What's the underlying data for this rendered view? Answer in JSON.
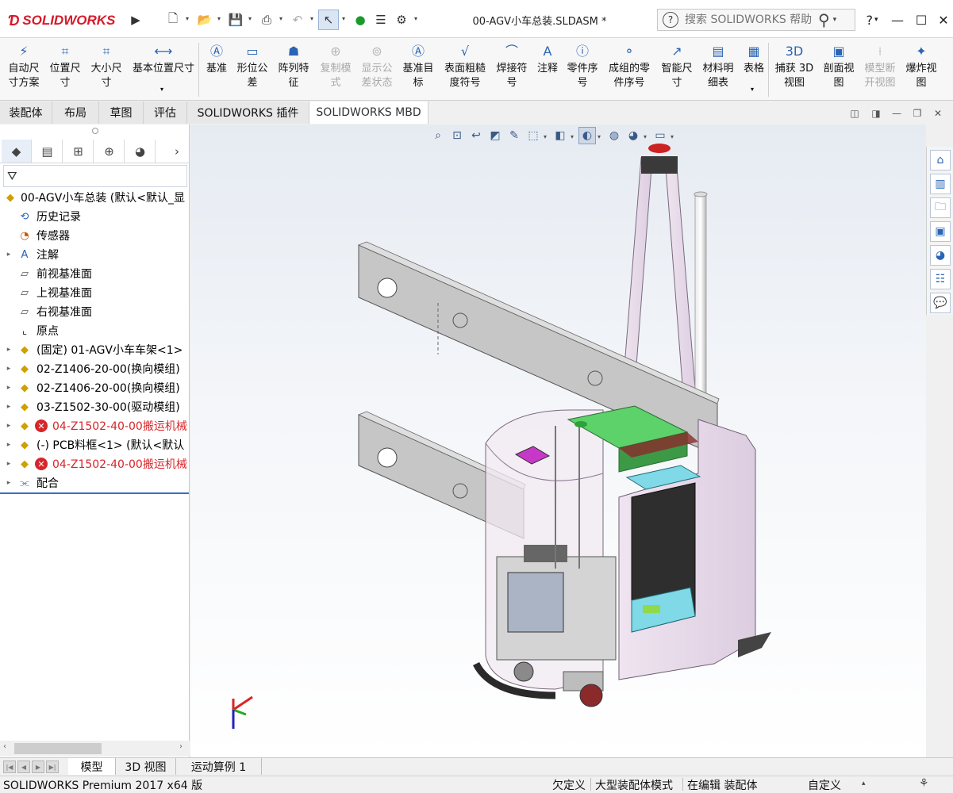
{
  "app": {
    "logo_text": "SOLIDWORKS",
    "document_title": "00-AGV小车总装.SLDASM *",
    "search_placeholder": "搜索 SOLIDWORKS 帮助",
    "help_label": "?"
  },
  "ribbon": {
    "items": [
      {
        "label": "自动尺\n寸方案",
        "icon": "auto-dimension-icon"
      },
      {
        "label": "位置尺\n寸",
        "icon": "location-dimension-icon"
      },
      {
        "label": "大小尺\n寸",
        "icon": "size-dimension-icon"
      },
      {
        "label": "基本位置尺寸",
        "icon": "basic-location-dimension-icon"
      },
      {
        "label": "基准",
        "icon": "datum-icon"
      },
      {
        "label": "形位公\n差",
        "icon": "geometric-tolerance-icon"
      },
      {
        "label": "阵列特\n征",
        "icon": "pattern-feature-icon"
      },
      {
        "label": "复制模\n式",
        "icon": "copy-scheme-icon",
        "disabled": true
      },
      {
        "label": "显示公\n差状态",
        "icon": "tolerance-status-icon",
        "disabled": true
      },
      {
        "label": "基准目\n标",
        "icon": "datum-target-icon"
      },
      {
        "label": "表面粗糙\n度符号",
        "icon": "surface-finish-icon"
      },
      {
        "label": "焊接符\n号",
        "icon": "weld-symbol-icon"
      },
      {
        "label": "注释",
        "icon": "note-icon"
      },
      {
        "label": "零件序\n号",
        "icon": "balloon-icon"
      },
      {
        "label": "成组的零\n件序号",
        "icon": "stacked-balloon-icon"
      },
      {
        "label": "智能尺\n寸",
        "icon": "smart-dimension-icon"
      },
      {
        "label": "材料明\n细表",
        "icon": "bom-icon"
      },
      {
        "label": "表格",
        "icon": "table-icon"
      },
      {
        "label": "捕获 3D\n视图",
        "icon": "capture-3d-view-icon"
      },
      {
        "label": "剖面视\n图",
        "icon": "section-view-icon"
      },
      {
        "label": "模型断\n开视图",
        "icon": "model-break-view-icon",
        "disabled": true
      },
      {
        "label": "爆炸视\n图",
        "icon": "explode-view-icon"
      }
    ]
  },
  "tabs": [
    {
      "label": "装配体"
    },
    {
      "label": "布局"
    },
    {
      "label": "草图"
    },
    {
      "label": "评估"
    },
    {
      "label": "SOLIDWORKS 插件"
    },
    {
      "label": "SOLIDWORKS MBD"
    }
  ],
  "tree": {
    "root": "00-AGV小车总装 (默认<默认_显",
    "items": [
      {
        "label": "历史记录",
        "icon": "history-icon",
        "expand": false
      },
      {
        "label": "传感器",
        "icon": "sensor-icon",
        "expand": false
      },
      {
        "label": "注解",
        "icon": "annotation-icon",
        "expand": true
      },
      {
        "label": "前视基准面",
        "icon": "plane-icon",
        "expand": false
      },
      {
        "label": "上视基准面",
        "icon": "plane-icon",
        "expand": false
      },
      {
        "label": "右视基准面",
        "icon": "plane-icon",
        "expand": false
      },
      {
        "label": "原点",
        "icon": "origin-icon",
        "expand": false
      },
      {
        "label": "(固定) 01-AGV小车车架<1>",
        "icon": "subassembly-icon",
        "expand": true
      },
      {
        "label": "02-Z1406-20-00(换向模组)",
        "icon": "subassembly-icon",
        "expand": true
      },
      {
        "label": "02-Z1406-20-00(换向模组)",
        "icon": "subassembly-icon",
        "expand": true
      },
      {
        "label": "03-Z1502-30-00(驱动模组)",
        "icon": "subassembly-icon",
        "expand": true
      },
      {
        "label": "04-Z1502-40-00搬运机械",
        "icon": "subassembly-icon",
        "expand": true,
        "error": true
      },
      {
        "label": "(-) PCB料框<1> (默认<默认",
        "icon": "subassembly-icon",
        "expand": true
      },
      {
        "label": "04-Z1502-40-00搬运机械",
        "icon": "subassembly-icon",
        "expand": true,
        "error": true
      },
      {
        "label": "配合",
        "icon": "mates-icon",
        "expand": true
      }
    ]
  },
  "bottom_tabs": [
    {
      "label": "模型"
    },
    {
      "label": "3D 视图"
    },
    {
      "label": "运动算例 1"
    }
  ],
  "status": {
    "product": "SOLIDWORKS Premium 2017 x64 版",
    "definition": "欠定义",
    "mode": "大型装配体模式",
    "editing": "在编辑 装配体",
    "custom": "自定义"
  },
  "colors": {
    "brand_red": "#d8192a",
    "accent_blue": "#3a6fc4",
    "model_pink": "#e8d8ea",
    "model_gray": "#c9c9c9",
    "board_green": "#5dd16a",
    "cyan_part": "#7fd9e6",
    "magenta_part": "#c838c8"
  }
}
